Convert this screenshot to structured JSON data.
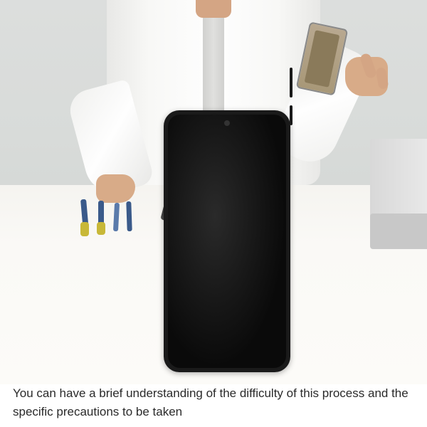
{
  "caption": {
    "text": "You can have a brief understanding of the difficulty of this process and the specific precautions to be taken"
  },
  "product": {
    "name": "smartphone-replacement-screen"
  }
}
